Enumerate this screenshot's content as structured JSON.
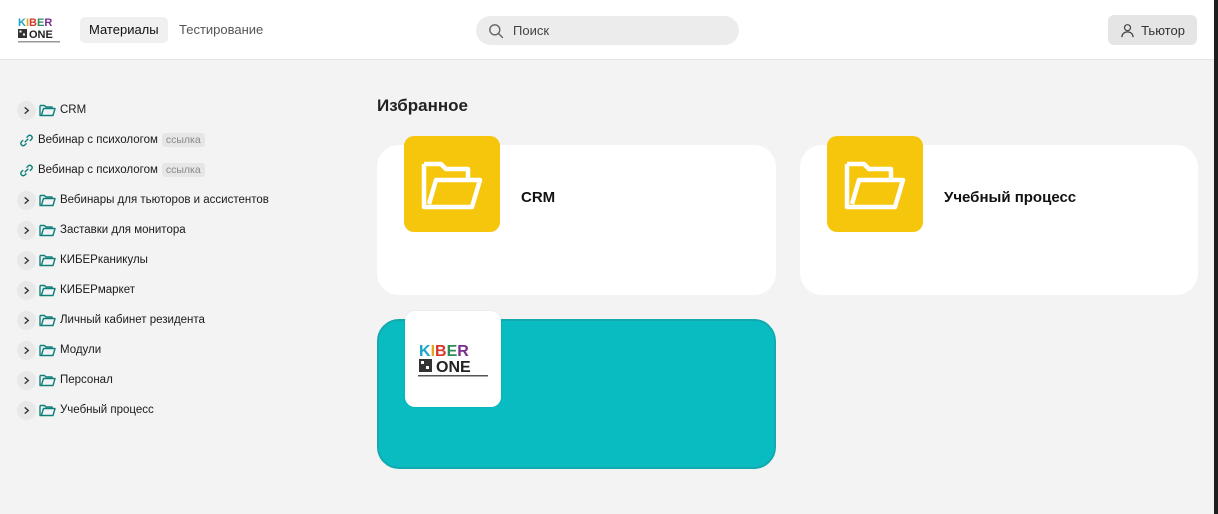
{
  "header": {
    "logo": {
      "line1": "KIBER",
      "line2": "ONE"
    },
    "tabs": [
      {
        "label": "Материалы",
        "active": true
      },
      {
        "label": "Тестирование",
        "active": false
      }
    ],
    "search": {
      "placeholder": "Поиск",
      "value": ""
    },
    "user": {
      "label": "Тьютор",
      "icon": "user-icon"
    }
  },
  "sidebar": {
    "items": [
      {
        "type": "folder",
        "label": "CRM"
      },
      {
        "type": "link",
        "label": "Вебинар с психологом",
        "badge": "ссылка"
      },
      {
        "type": "link",
        "label": "Вебинар с психологом",
        "badge": "ссылка"
      },
      {
        "type": "folder",
        "label": "Вебинары для тьюторов и ассистентов"
      },
      {
        "type": "folder",
        "label": "Заставки для монитора"
      },
      {
        "type": "folder",
        "label": "КИБЕРканикулы"
      },
      {
        "type": "folder",
        "label": "КИБЕРмаркет"
      },
      {
        "type": "folder",
        "label": "Личный кабинет резидента"
      },
      {
        "type": "folder",
        "label": "Модули"
      },
      {
        "type": "folder",
        "label": "Персонал"
      },
      {
        "type": "folder",
        "label": "Учебный процесс"
      }
    ]
  },
  "main": {
    "title": "Избранное",
    "favorites": [
      {
        "title": "CRM",
        "icon": "folder-icon",
        "tile_color": "#f6c60c"
      },
      {
        "title": "Учебный процесс",
        "icon": "folder-icon",
        "tile_color": "#f6c60c"
      },
      {
        "title": "",
        "icon": "kiberone-logo",
        "card_color": "#08bcc1"
      }
    ]
  },
  "colors": {
    "accent_teal": "#08bcc1",
    "folder_yellow": "#f6c60c",
    "folder_icon_teal": "#0f7f7c"
  }
}
